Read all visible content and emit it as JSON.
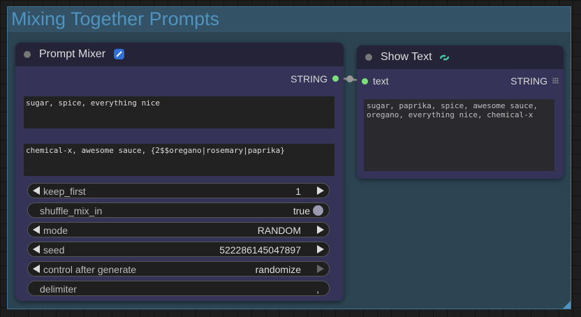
{
  "group": {
    "title": "Mixing Together Prompts",
    "color": "#4f93c0"
  },
  "prompt_mixer": {
    "title": "Prompt Mixer",
    "output_label": "STRING",
    "text_1": "sugar, spice, everything nice",
    "text_2": "chemical-x, awesome sauce, {2$$oregano|rosemary|paprika}",
    "widgets": {
      "keep_first": {
        "label": "keep_first",
        "value": "1"
      },
      "shuffle_mix_in": {
        "label": "shuffle_mix_in",
        "value": "true"
      },
      "mode": {
        "label": "mode",
        "value": "RANDOM"
      },
      "seed": {
        "label": "seed",
        "value": "522286145047897"
      },
      "control_after_generate": {
        "label": "control after generate",
        "value": "randomize"
      },
      "delimiter": {
        "label": "delimiter",
        "value": ","
      }
    }
  },
  "show_text": {
    "title": "Show Text",
    "input_label": "text",
    "output_label": "STRING",
    "output_text": "sugar, paprika, spice, awesome sauce,\noregano, everything nice, chemical-x"
  },
  "colors": {
    "slot": "#7be07b",
    "node_body": "#353358",
    "node_header": "#242338",
    "group_bg": "#2d4553"
  }
}
